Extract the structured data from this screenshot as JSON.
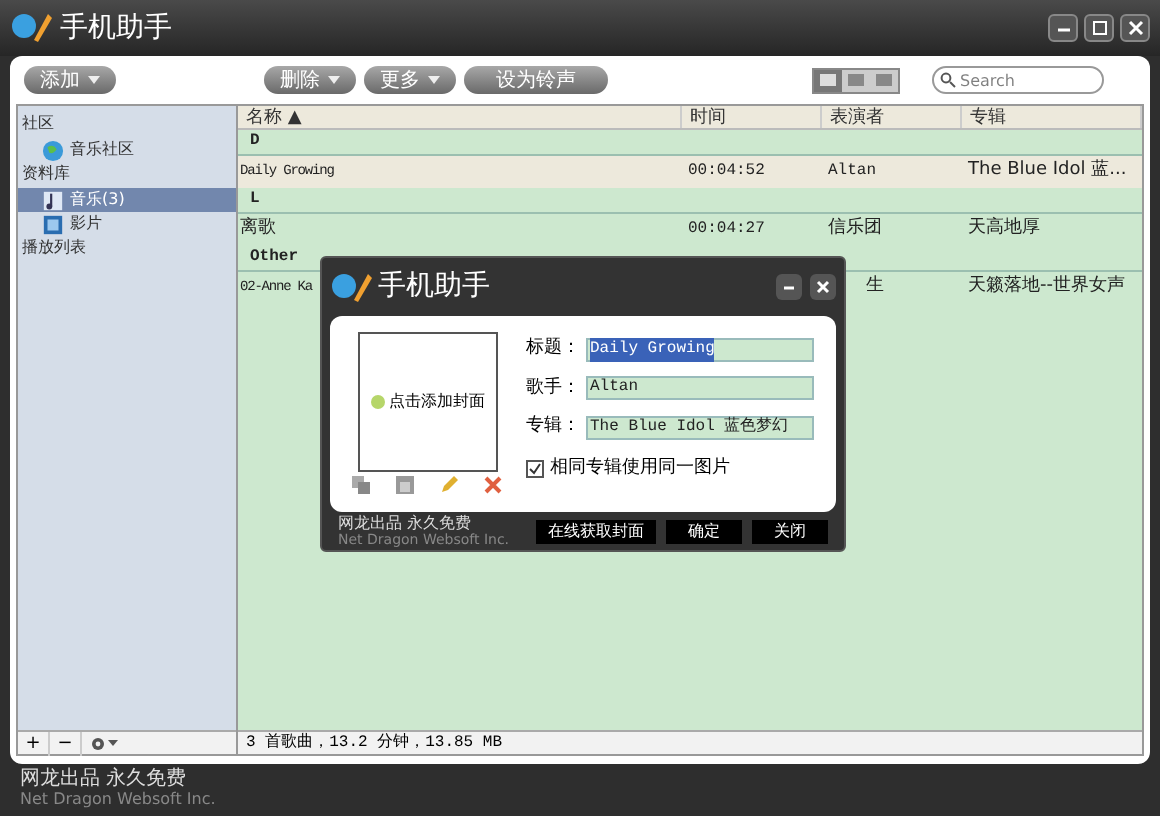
{
  "window": {
    "title": "手机助手"
  },
  "toolbar": {
    "buttons": [
      {
        "label": "添加",
        "dropdown": true
      },
      {
        "label": "删除",
        "dropdown": true
      },
      {
        "label": "更多",
        "dropdown": true
      },
      {
        "label": "设为铃声",
        "dropdown": false
      }
    ],
    "views": [
      {
        "selected": true
      },
      {
        "selected": false
      },
      {
        "selected": false
      }
    ],
    "search": {
      "placeholder": "Search"
    }
  },
  "sidebar": {
    "sections": [
      {
        "title": "社区",
        "items": [
          {
            "label": "音乐社区",
            "kind": "globe",
            "selected": false
          }
        ]
      },
      {
        "title": "资料库",
        "items": [
          {
            "label": "音乐(3)",
            "kind": "music",
            "selected": true
          },
          {
            "label": "影片",
            "kind": "film",
            "selected": false
          }
        ]
      },
      {
        "title": "播放列表"
      }
    ]
  },
  "table": {
    "columns": [
      "名称 ▲",
      "时间",
      "表演者",
      "专辑"
    ],
    "rows": [
      {
        "kind": "group",
        "label": "D"
      },
      {
        "kind": "song",
        "selected": true,
        "cells": [
          "Daily Growing",
          "00:04:52",
          "Altan",
          "The Blue Idol 蓝..."
        ]
      },
      {
        "kind": "group",
        "label": "L"
      },
      {
        "kind": "song",
        "selected": false,
        "cells": [
          "离歌",
          "00:04:27",
          "信乐团",
          "天高地厚"
        ]
      },
      {
        "kind": "group",
        "label": "Other"
      },
      {
        "kind": "song",
        "selected": false,
        "cells": [
          "02-Anne Ka",
          "",
          "生",
          "天籁落地--世界女声"
        ]
      }
    ]
  },
  "sidebar_footer": {
    "buttons": [
      "+",
      "−"
    ]
  },
  "status_bar": "3 首歌曲，13.2 分钟，13.85 MB",
  "footer": {
    "line1": "网龙出品 永久免费",
    "line2": "Net Dragon Websoft Inc."
  },
  "dialog": {
    "title": "手机助手",
    "cover_hint": "点击添加封面",
    "fields": [
      {
        "label": "标题：",
        "value": "Daily Growing",
        "selected": true
      },
      {
        "label": "歌手：",
        "value": "Altan",
        "selected": false
      },
      {
        "label": "专辑：",
        "value": "The Blue Idol 蓝色梦幻",
        "selected": false
      }
    ],
    "checkbox": {
      "label": "相同专辑使用同一图片",
      "checked": true
    },
    "footer": {
      "line1": "网龙出品 永久免费",
      "line2": "Net Dragon Websoft Inc."
    },
    "buttons": [
      "在线获取封面",
      "确定",
      "关闭"
    ]
  }
}
